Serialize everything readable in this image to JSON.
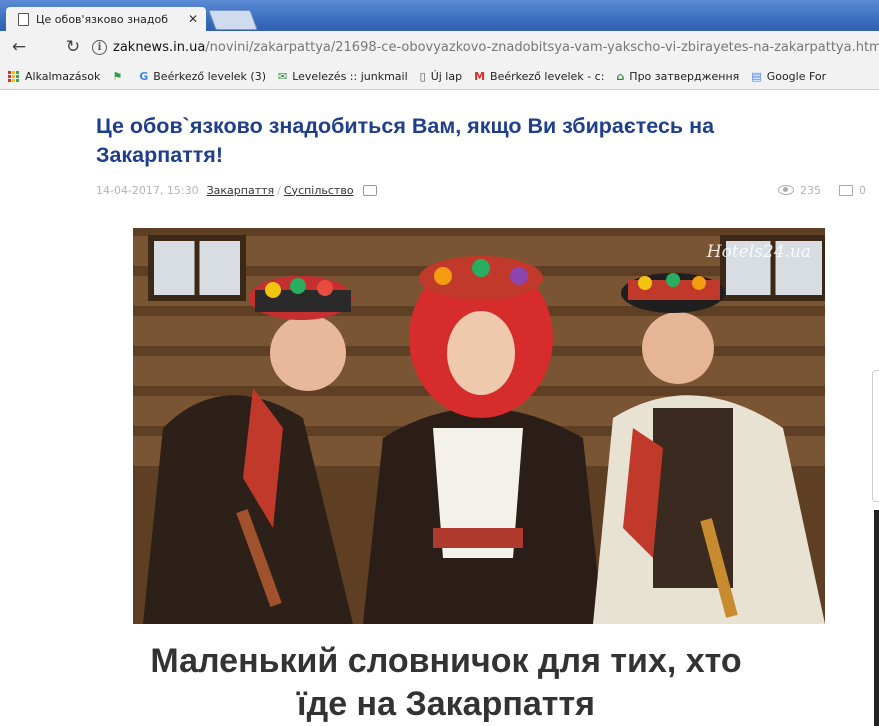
{
  "browser": {
    "tab_title": "Це обов'язково знадоб",
    "url_host": "zaknews.in.ua",
    "url_path": "/novini/zakarpattya/21698-ce-obovyazkovo-znadobitsya-vam-yakscho-vi-zbirayetes-na-zakarpattya.html"
  },
  "bookmarks": [
    {
      "icon": "apps-icon",
      "label": "Alkalmazások"
    },
    {
      "icon": "flag-icon",
      "label": ""
    },
    {
      "icon": "google-icon",
      "label": "Beérkező levelek (3)"
    },
    {
      "icon": "mail-icon",
      "label": "Levelezés :: junkmail"
    },
    {
      "icon": "page-icon",
      "label": "Új lap"
    },
    {
      "icon": "gmail-icon",
      "label": "Beérkező levelek - c:"
    },
    {
      "icon": "house-icon",
      "label": "Про затвердження"
    },
    {
      "icon": "google-forms-icon",
      "label": "Google For"
    }
  ],
  "article": {
    "title": "Це обов`язково знадобиться Вам, якщо Ви збираєтесь на Закарпаття!",
    "date": "14-04-2017, 15:30",
    "category1": "Закарпаття",
    "separator": "/",
    "category2": "Суспільство",
    "views": "235",
    "comments": "0",
    "watermark": "Hotels24.ua",
    "caption_line1": "Маленький словничок для тих, хто",
    "caption_line2": "їде на Закарпаття"
  },
  "colors": {
    "title": "#1f3f8c",
    "tabbar": "#3d6fbf"
  }
}
